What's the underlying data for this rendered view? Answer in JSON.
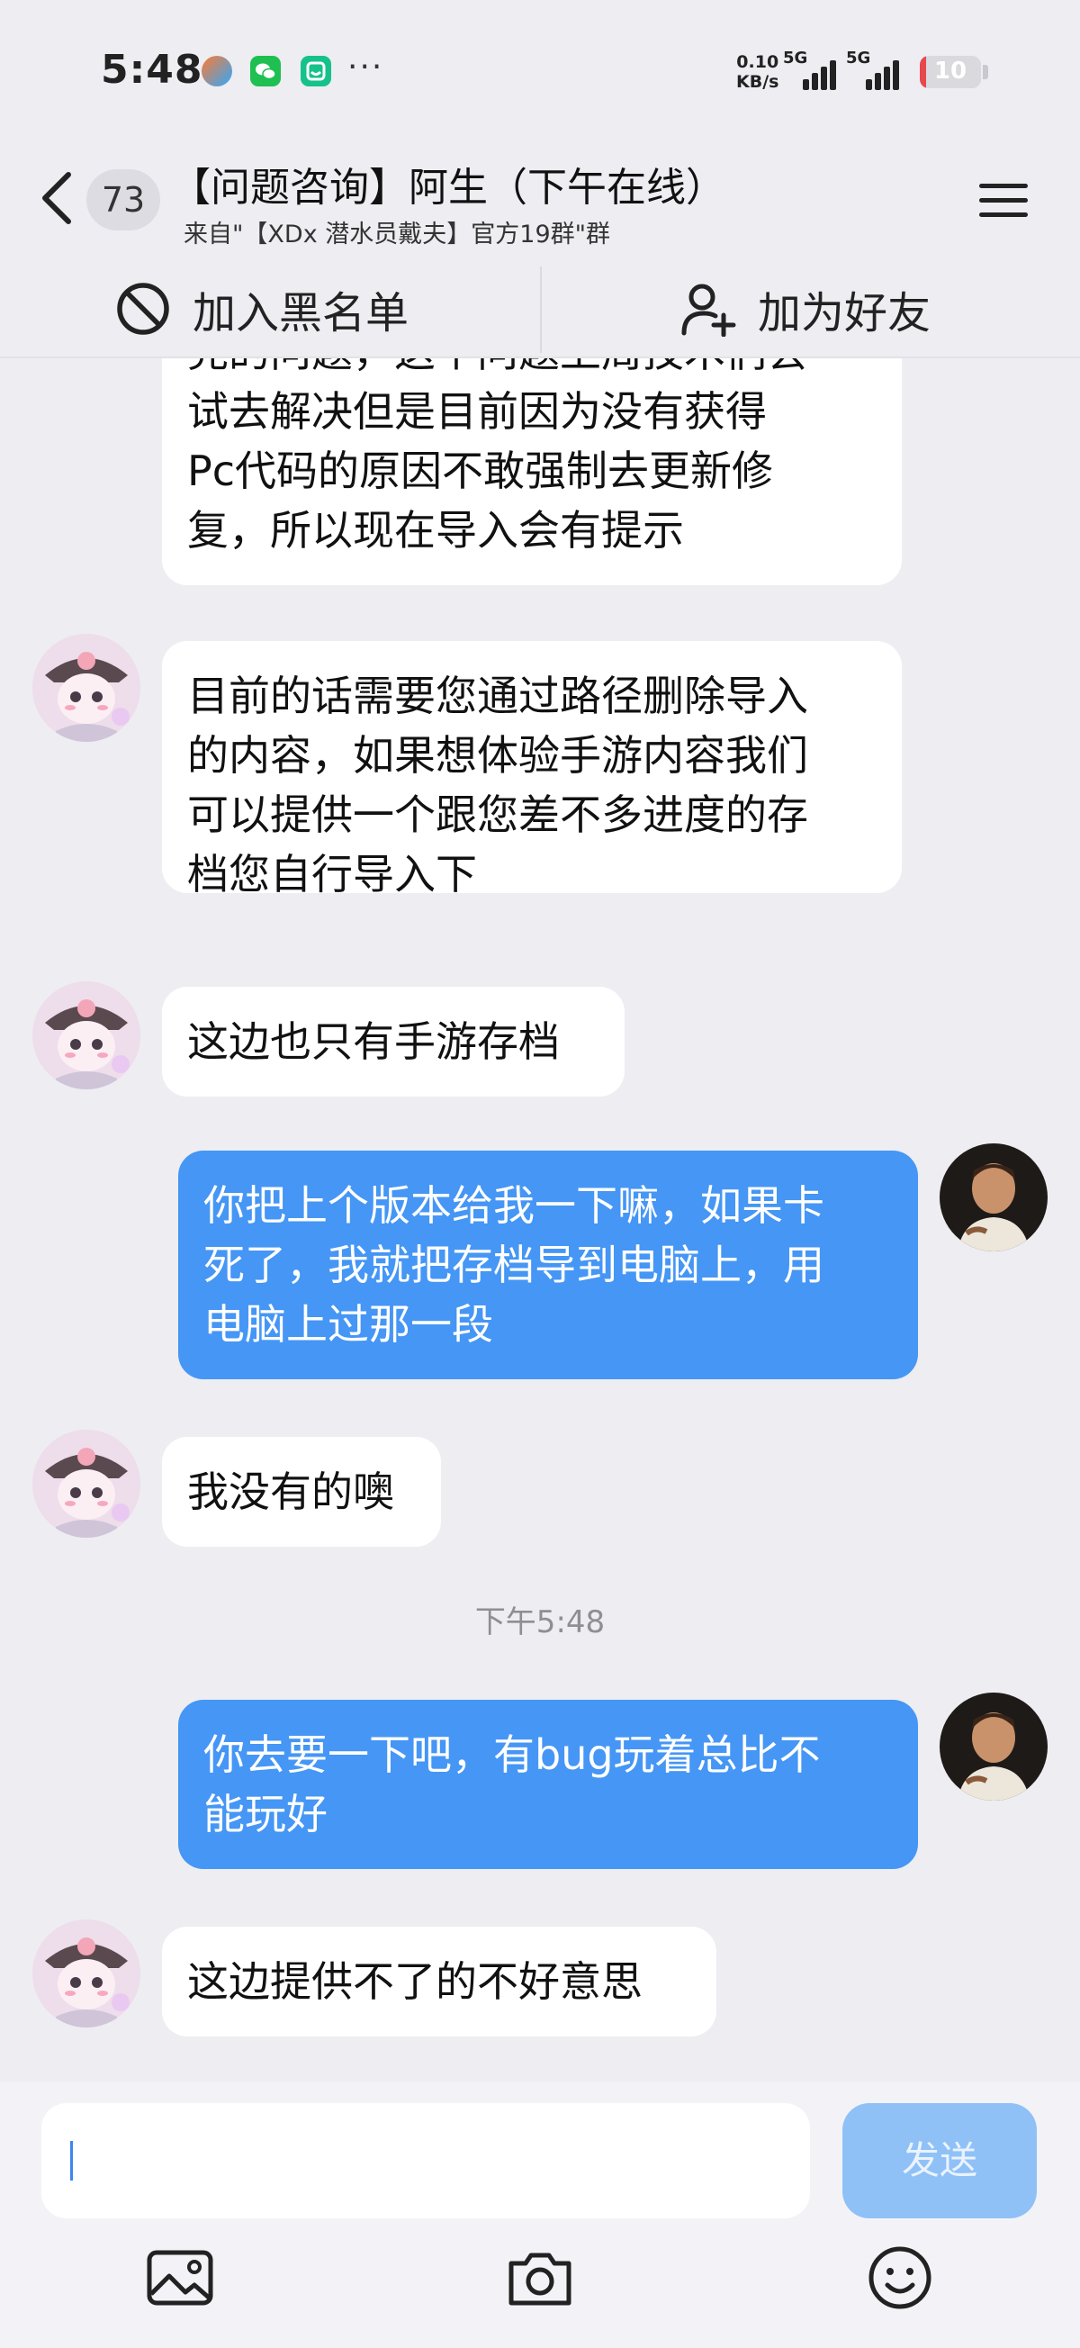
{
  "status_bar": {
    "time": "5:48",
    "net_speed_value": "0.10",
    "net_speed_unit": "KB/s",
    "signal_1": "5G",
    "signal_2": "5G",
    "battery": "10",
    "battery_level": 0.1,
    "app_icons": [
      "flower-app-icon",
      "wechat-icon",
      "notes-app-icon"
    ],
    "more": "···"
  },
  "header": {
    "unread_count": "73",
    "title": "【问题咨询】阿生（下午在线）",
    "subtitle": "来自\"【XDx 潜水员戴夫】官方19群\"群"
  },
  "actions": {
    "block": "加入黑名单",
    "add_friend": "加为好友"
  },
  "messages": [
    {
      "side": "left",
      "lines": [
        "完的问题，这个问题上周技术们会",
        "试去解决但是目前因为没有获得",
        "Pc代码的原因不敢强制去更新修",
        "复，所以现在导入会有提示"
      ]
    },
    {
      "side": "left",
      "lines": [
        "目前的话需要您通过路径删除导入",
        "的内容，如果想体验手游内容我们",
        "可以提供一个跟您差不多进度的存",
        "档您自行导入下"
      ]
    },
    {
      "side": "left",
      "lines": [
        "这边也只有手游存档"
      ]
    },
    {
      "side": "right",
      "lines": [
        "你把上个版本给我一下嘛，如果卡",
        "死了，我就把存档导到电脑上，用",
        "电脑上过那一段"
      ]
    },
    {
      "side": "left",
      "lines": [
        "我没有的噢"
      ]
    },
    {
      "side": "right",
      "lines": [
        "你去要一下吧，有bug玩着总比不",
        "能玩好"
      ]
    },
    {
      "side": "left",
      "lines": [
        "这边提供不了的不好意思"
      ]
    }
  ],
  "timestamp": "下午5:48",
  "input": {
    "value": "",
    "send_label": "发送"
  },
  "toolbar": [
    "image-icon",
    "camera-icon",
    "emoji-icon"
  ],
  "colors": {
    "background": "#EDEDF2",
    "bubble_left": "#FFFFFF",
    "bubble_right": "#4596F5",
    "send_disabled": "#8FC1F7",
    "battery_low": "#E5484D"
  }
}
